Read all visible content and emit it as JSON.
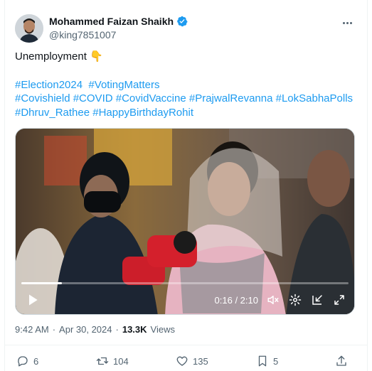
{
  "author": {
    "display_name": "Mohammed Faizan Shaikh",
    "handle": "@king7851007"
  },
  "tweet": {
    "text": "Unemployment 👇",
    "hashtag_lines": [
      [
        "#Election2024",
        "#VotingMatters"
      ],
      [
        "#Covishield",
        "#COVID",
        "#CovidVaccine",
        "#PrajwalRevanna",
        "#LokSabhaPolls"
      ],
      [
        "#Dhruv_Rathee",
        "#HappyBirthdayRohit"
      ]
    ]
  },
  "video": {
    "time": "0:16 / 2:10",
    "progress": 0.123
  },
  "meta": {
    "time": "9:42 AM",
    "separator1": "·",
    "date": "Apr 30, 2024",
    "separator2": "·",
    "views_count": "13.3K",
    "views_label": "Views"
  },
  "actions": {
    "replies": "6",
    "reposts": "104",
    "likes": "135",
    "bookmarks": "5"
  },
  "colors": {
    "accent": "#1d9bf0",
    "text": "#0f1419",
    "secondary": "#536471"
  },
  "icons": [
    "verified-badge-icon",
    "more-icon",
    "play-icon",
    "mute-icon",
    "settings-icon",
    "pip-icon",
    "fullscreen-icon",
    "reply-icon",
    "repost-icon",
    "like-icon",
    "bookmark-icon",
    "share-icon"
  ]
}
